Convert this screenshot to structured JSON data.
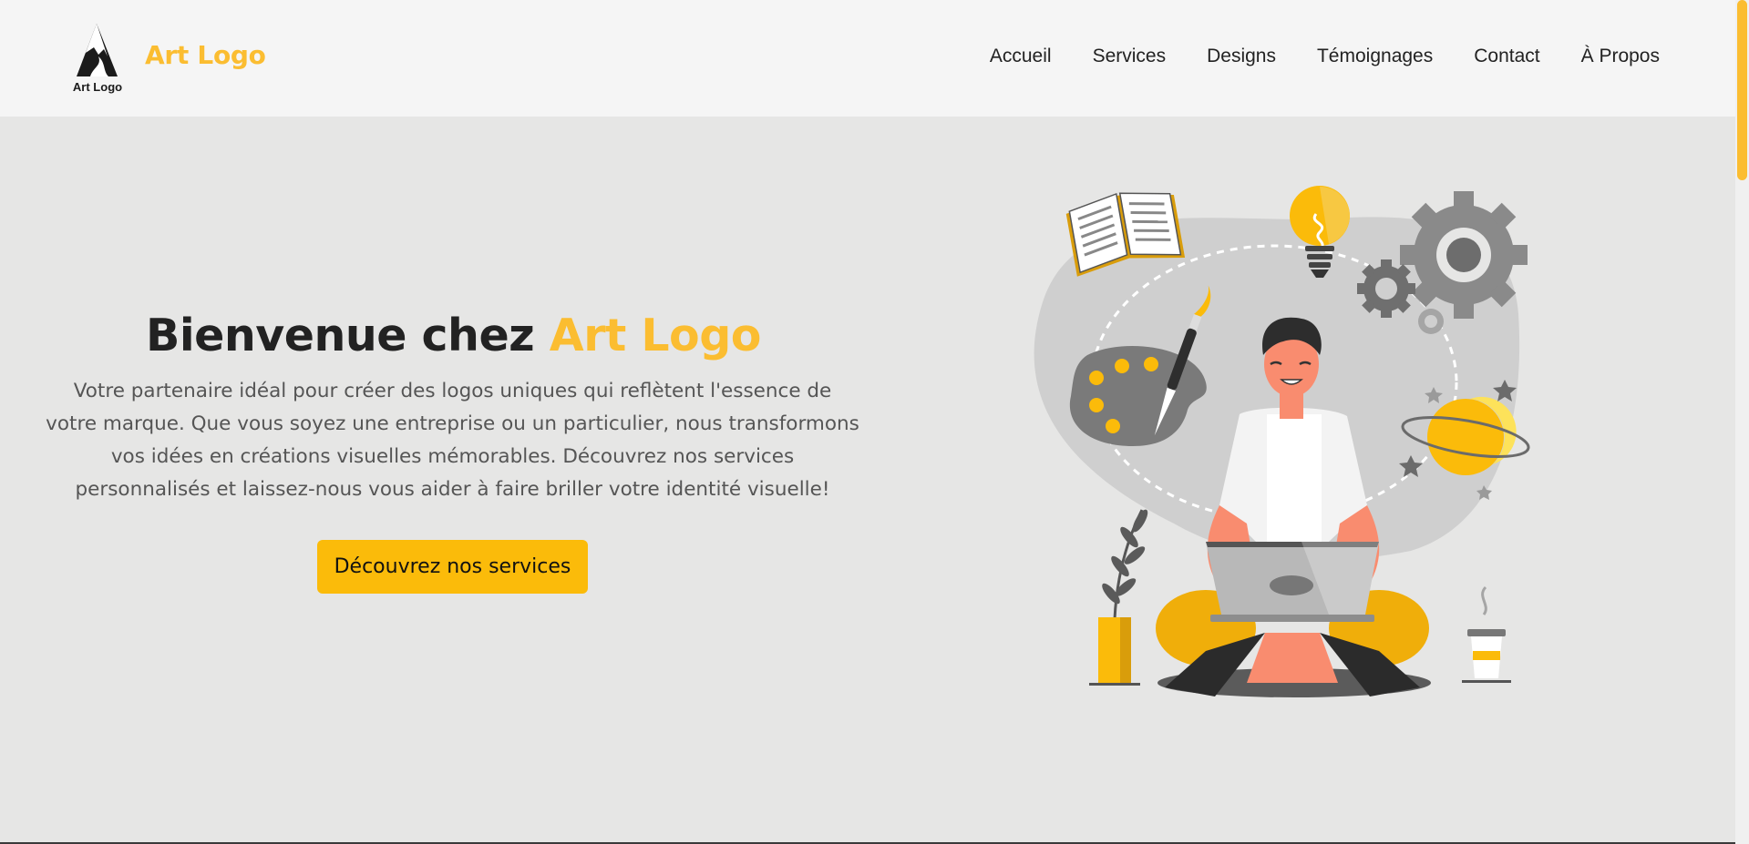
{
  "brand": {
    "name": "Art Logo",
    "logo_caption": "Art Logo"
  },
  "nav": {
    "items": [
      {
        "label": "Accueil"
      },
      {
        "label": "Services"
      },
      {
        "label": "Designs"
      },
      {
        "label": "Témoignages"
      },
      {
        "label": "Contact"
      },
      {
        "label": "À Propos"
      }
    ]
  },
  "hero": {
    "title_prefix": "Bienvenue chez ",
    "title_accent": "Art Logo",
    "description": "Votre partenaire idéal pour créer des logos uniques qui reflètent l'essence de votre marque. Que vous soyez une entreprise ou un particulier, nous transformons vos idées en créations visuelles mémorables. Découvrez nos services personnalisés et laissez-nous vous aider à faire briller votre identité visuelle!",
    "cta_label": "Découvrez nos services"
  },
  "colors": {
    "accent": "#fbbd31",
    "button": "#fbbb0a",
    "header_bg": "#f5f5f5",
    "page_bg": "#e6e6e5"
  },
  "icons": {
    "logo": "mountain-logo-icon",
    "illustration": "designer-with-laptop-illustration"
  }
}
